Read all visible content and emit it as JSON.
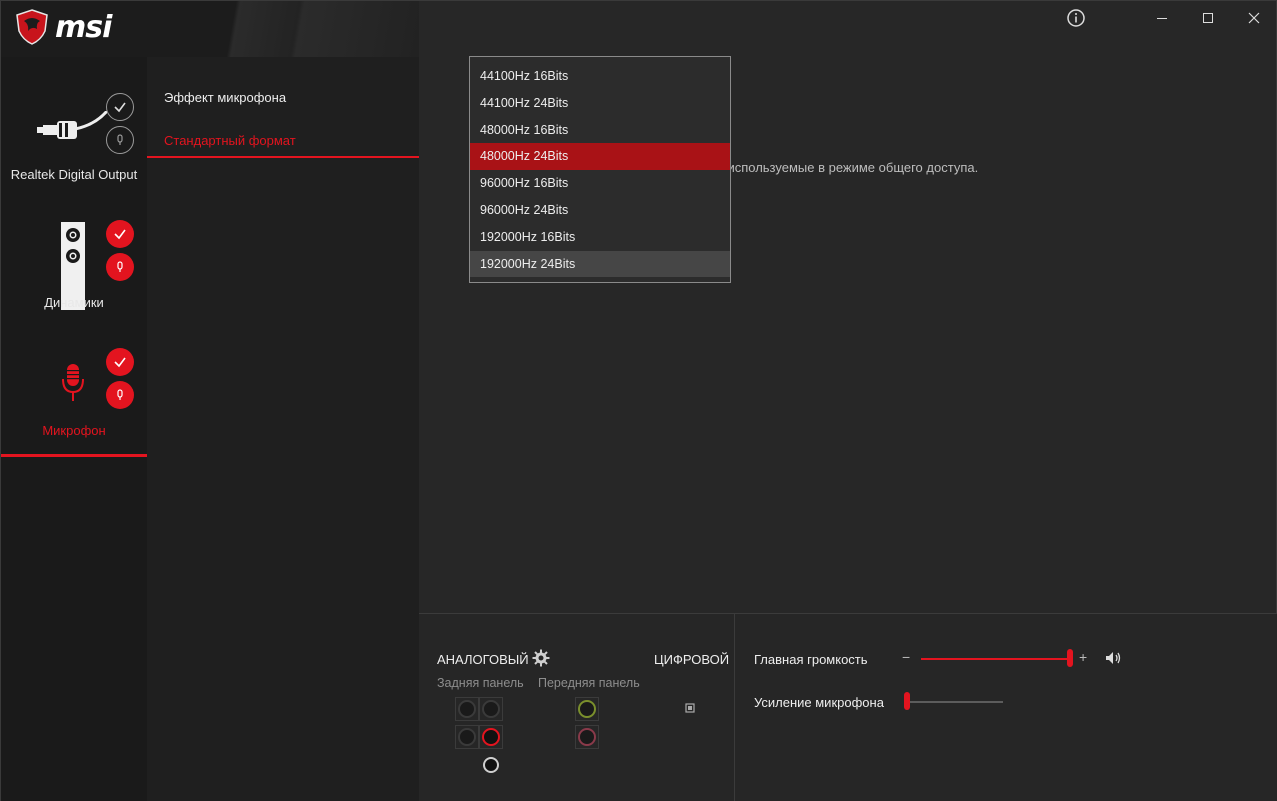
{
  "brand": {
    "logo_text": "msi"
  },
  "window": {
    "info_icon": "info-icon",
    "minimize_icon": "minimize-icon",
    "maximize_icon": "maximize-icon",
    "close_icon": "close-icon"
  },
  "devices": [
    {
      "name": "Realtek Digital Output",
      "active": false,
      "icon": "spdif-cable-icon"
    },
    {
      "name": "Динамики",
      "active": false,
      "icon": "speaker-icon"
    },
    {
      "name": "Микрофон",
      "active": true,
      "icon": "microphone-icon"
    }
  ],
  "settings_menu": {
    "items": [
      {
        "label": "Эффект микрофона",
        "active": false
      },
      {
        "label": "Стандартный формат",
        "active": true
      }
    ]
  },
  "main": {
    "description_partial": "сть, используемые в режиме общего доступа."
  },
  "format_dropdown": {
    "options": [
      "44100Hz 16Bits",
      "44100Hz 24Bits",
      "48000Hz 16Bits",
      "48000Hz 24Bits",
      "96000Hz 16Bits",
      "96000Hz 24Bits",
      "192000Hz 16Bits",
      "192000Hz 24Bits"
    ],
    "selected": "48000Hz 24Bits",
    "hovered": "192000Hz 24Bits"
  },
  "bottom": {
    "analog_label": "АНАЛОГОВЫЙ",
    "digital_label": "ЦИФРОВОЙ",
    "rear_panel_label": "Задняя панель",
    "front_panel_label": "Передняя панель",
    "master_volume_label": "Главная громкость",
    "mic_boost_label": "Усиление микрофона",
    "minus": "−",
    "plus": "+",
    "master_volume_level": 1.0,
    "mic_boost_level": 0.0,
    "colors": {
      "accent": "#e3141f",
      "front_green": "#7a8f2c",
      "front_pink": "#8a3a4a"
    }
  }
}
